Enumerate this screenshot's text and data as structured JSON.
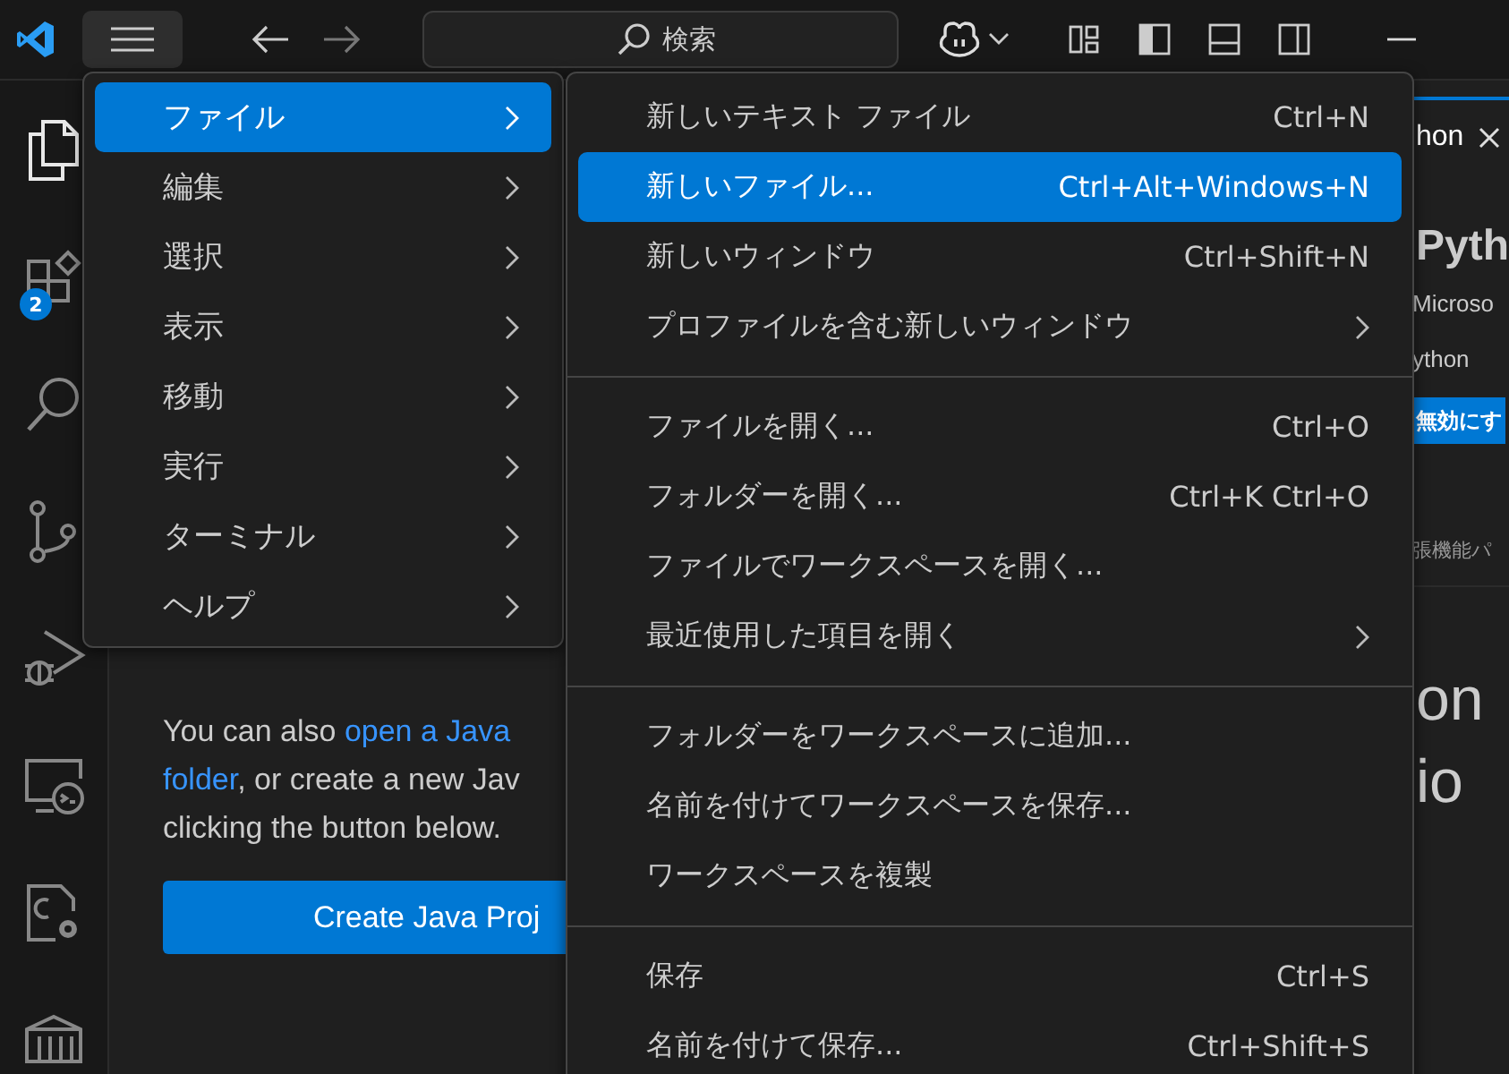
{
  "title_bar": {
    "search": {
      "placeholder": "検索"
    }
  },
  "activity_bar": [
    {
      "kind": "explorer",
      "selected": true
    },
    {
      "kind": "extensions",
      "selected": false,
      "badge": "2"
    },
    {
      "kind": "search",
      "selected": false
    },
    {
      "kind": "source-control",
      "selected": false
    },
    {
      "kind": "run-debug",
      "selected": false
    },
    {
      "kind": "remote",
      "selected": false
    },
    {
      "kind": "cpp",
      "selected": false
    },
    {
      "kind": "container",
      "selected": false
    }
  ],
  "editor": {
    "lines": [
      [
        {
          "text": "You can also ",
          "link": false
        },
        {
          "text": "open a Java",
          "link": true
        }
      ],
      [
        {
          "text": "folder",
          "link": true
        },
        {
          "text": ", or create a new Jav",
          "link": false
        }
      ],
      [
        {
          "text": "clicking the button below.",
          "link": false
        }
      ]
    ],
    "button": "Create Java Proj"
  },
  "side_editor": {
    "tab": "hon",
    "title": "Pyth",
    "publisher": "Microso",
    "subtitle": "ython",
    "button": "無効にす",
    "note": "張機能パ",
    "heading_lines": [
      "on",
      "io"
    ]
  },
  "main_menu": [
    {
      "label": "ファイル",
      "selected": true
    },
    {
      "label": "編集",
      "selected": false
    },
    {
      "label": "選択",
      "selected": false
    },
    {
      "label": "表示",
      "selected": false
    },
    {
      "label": "移動",
      "selected": false
    },
    {
      "label": "実行",
      "selected": false
    },
    {
      "label": "ターミナル",
      "selected": false
    },
    {
      "label": "ヘルプ",
      "selected": false
    }
  ],
  "file_menu": [
    [
      {
        "label": "新しいテキスト ファイル",
        "shortcut": "Ctrl+N",
        "submenu": false,
        "selected": false
      },
      {
        "label": "新しいファイル...",
        "shortcut": "Ctrl+Alt+Windows+N",
        "submenu": false,
        "selected": true
      },
      {
        "label": "新しいウィンドウ",
        "shortcut": "Ctrl+Shift+N",
        "submenu": false,
        "selected": false
      },
      {
        "label": "プロファイルを含む新しいウィンドウ",
        "submenu": true,
        "selected": false
      }
    ],
    [
      {
        "label": "ファイルを開く...",
        "shortcut": "Ctrl+O",
        "submenu": false,
        "selected": false
      },
      {
        "label": "フォルダーを開く...",
        "shortcut": "Ctrl+K Ctrl+O",
        "submenu": false,
        "selected": false
      },
      {
        "label": "ファイルでワークスペースを開く...",
        "submenu": false,
        "selected": false
      },
      {
        "label": "最近使用した項目を開く",
        "submenu": true,
        "selected": false
      }
    ],
    [
      {
        "label": "フォルダーをワークスペースに追加...",
        "submenu": false,
        "selected": false
      },
      {
        "label": "名前を付けてワークスペースを保存...",
        "submenu": false,
        "selected": false
      },
      {
        "label": "ワークスペースを複製",
        "submenu": false,
        "selected": false
      }
    ],
    [
      {
        "label": "保存",
        "shortcut": "Ctrl+S",
        "submenu": false,
        "selected": false
      },
      {
        "label": "名前を付けて保存...",
        "shortcut": "Ctrl+Shift+S",
        "submenu": false,
        "selected": false
      }
    ]
  ]
}
